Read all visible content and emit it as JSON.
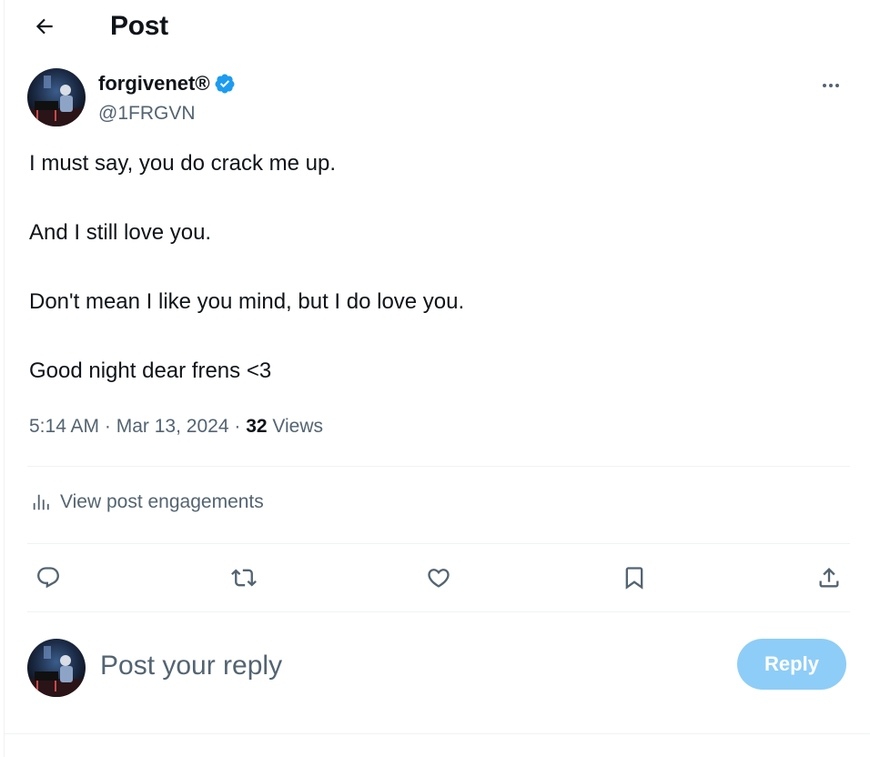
{
  "header": {
    "back_icon": "arrow-left-icon",
    "title": "Post"
  },
  "author": {
    "name": "forgivenet®",
    "verified_icon": "verified-badge-icon",
    "verified_color": "#1d9bf0",
    "handle": "@1FRGVN",
    "more_icon": "more-horizontal-icon"
  },
  "post": {
    "paragraphs": [
      "I must say, you do crack me up.",
      "And I still love you.",
      "Don't mean I like you mind, but I do love you.",
      "Good night dear frens <3"
    ],
    "time": "5:14 AM",
    "date": "Mar 13, 2024",
    "separator": "·",
    "views_count": "32",
    "views_label": "Views"
  },
  "engagements": {
    "icon": "analytics-icon",
    "label": "View post engagements"
  },
  "actions": [
    {
      "icon": "reply-icon"
    },
    {
      "icon": "repost-icon"
    },
    {
      "icon": "like-icon"
    },
    {
      "icon": "bookmark-icon"
    },
    {
      "icon": "share-icon"
    }
  ],
  "reply": {
    "placeholder": "Post your reply",
    "button_label": "Reply",
    "button_color": "#8ecdf7"
  },
  "colors": {
    "text_primary": "#0f1419",
    "text_secondary": "#536471",
    "accent": "#1d9bf0",
    "divider": "#eff3f4"
  }
}
